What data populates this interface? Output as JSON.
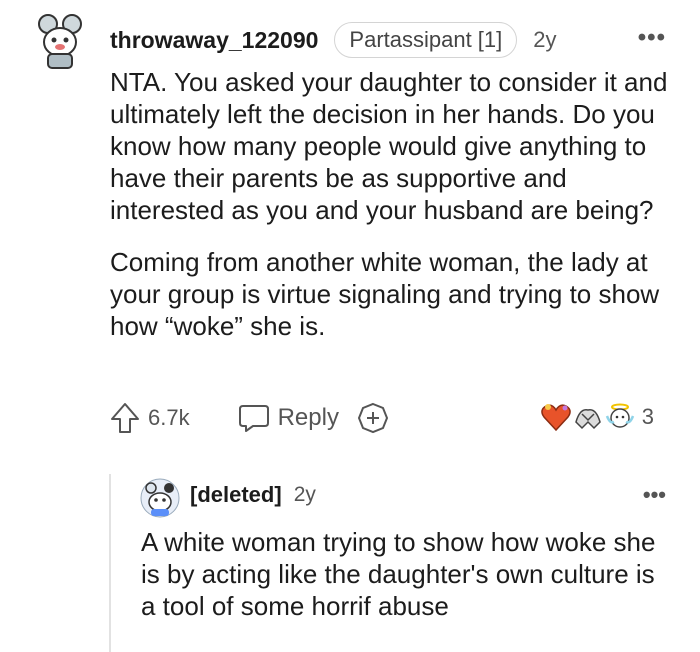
{
  "comment": {
    "username": "throwaway_122090",
    "flair": "Partassipant [1]",
    "age": "2y",
    "more_label": "•••",
    "paragraphs": [
      "NTA. You asked your daughter to consider it and ultimately left the decision in her hands. Do you know how many people would give anything to have their parents be as supportive and interested as you and your husband are being?",
      "Coming from another white woman, the lady at your group is virtue signaling and trying to show how “woke” she is."
    ],
    "votes": "6.7k",
    "reply_label": "Reply",
    "award_count": "3"
  },
  "reply": {
    "username": "[deleted]",
    "age": "2y",
    "more_label": "•••",
    "text": "A white woman trying to show how woke she is by acting like the daughter's own culture is a tool of some horrif abuse"
  }
}
